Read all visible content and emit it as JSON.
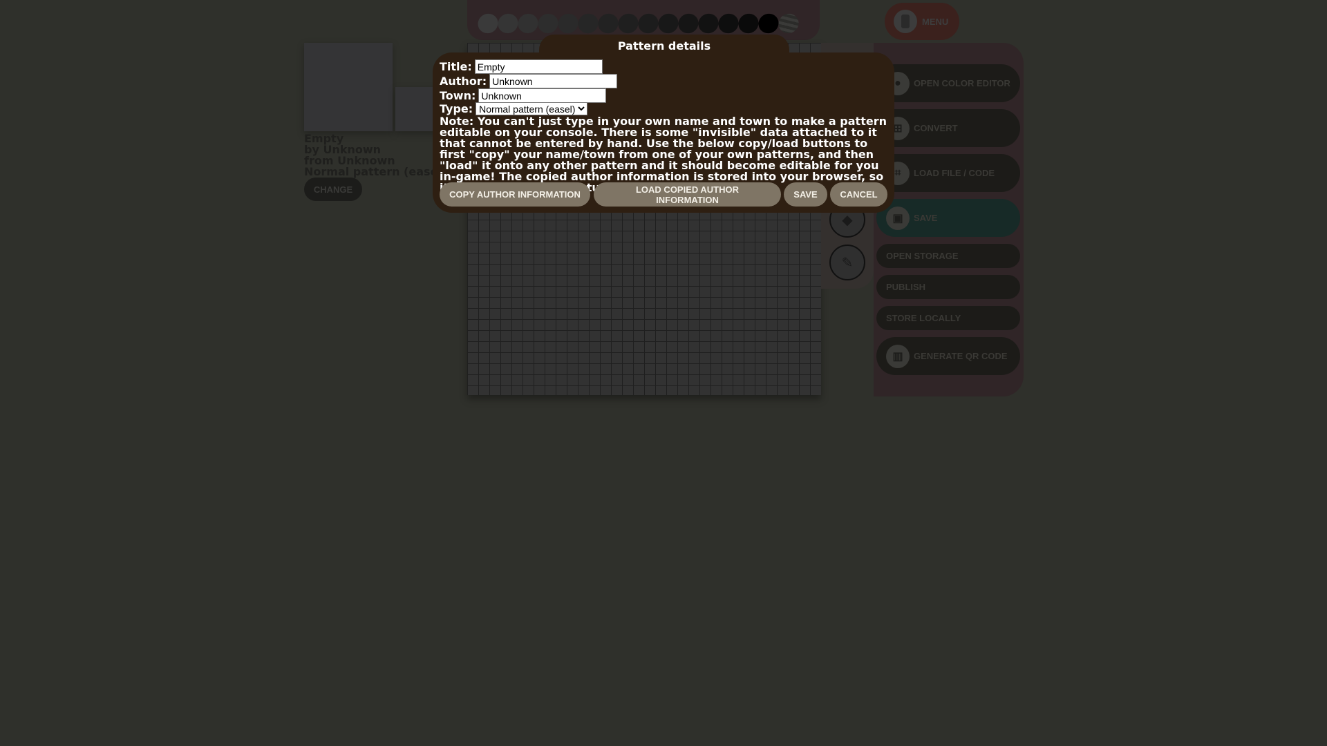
{
  "preview": {
    "title": "Empty",
    "author_line": "by Unknown",
    "town_line": "from Unknown",
    "type_line": "Normal pattern (easel)",
    "change_label": "CHANGE"
  },
  "palette": {
    "swatches": [
      "#3a3a3a",
      "#353535",
      "#313131",
      "#2d2d2d",
      "#2a2a2a",
      "#262626",
      "#222222",
      "#1f1f1f",
      "#1c1c1c",
      "#181818",
      "#151515",
      "#121212",
      "#0e0e0e",
      "#0a0a0a",
      "#000000"
    ],
    "clear_icon": "transparent-swatch-icon"
  },
  "tools": [
    {
      "name": "paint-bucket-icon",
      "glyph": "◆"
    },
    {
      "name": "eyedropper-icon",
      "glyph": "✎"
    }
  ],
  "menu": {
    "label": "MENU",
    "icon": "phone-icon"
  },
  "actions": [
    {
      "label": "OPEN COLOR EDITOR",
      "icon": "palette-icon",
      "glyph": "🎨",
      "size": "big"
    },
    {
      "label": "CONVERT",
      "icon": "image-convert-icon",
      "glyph": "⊞",
      "size": "big"
    },
    {
      "label": "LOAD FILE / CODE",
      "icon": "scan-icon",
      "glyph": "⌗",
      "size": "big"
    },
    {
      "label": "SAVE",
      "icon": "floppy-icon",
      "glyph": "▣",
      "size": "big"
    },
    {
      "label": "OPEN STORAGE",
      "size": "small"
    },
    {
      "label": "PUBLISH",
      "size": "small"
    },
    {
      "label": "STORE LOCALLY",
      "size": "small"
    },
    {
      "label": "GENERATE QR CODE",
      "icon": "qr-scan-icon",
      "glyph": "▥",
      "size": "big"
    }
  ],
  "modal": {
    "title": "Pattern details",
    "title_label": "Title:",
    "title_value": "Empty",
    "author_label": "Author:",
    "author_value": "Unknown",
    "town_label": "Town:",
    "town_value": "Unknown",
    "type_label": "Type:",
    "type_value": "Normal pattern (easel)",
    "note": "Note: You can't just type in your own name and town to make a pattern editable on your console. There is some \"invisible\" data attached to it that cannot be entered by hand. Use the below copy/load buttons to first \"copy\" your name/town from one of your own patterns, and then \"load\" it onto any other pattern and it should become editable for you in-game! The copied author information is stored into your browser, so it'll be there for your future visits as well.",
    "buttons": {
      "copy": "COPY AUTHOR INFORMATION",
      "load": "LOAD COPIED AUTHOR INFORMATION",
      "save": "SAVE",
      "cancel": "CANCEL"
    }
  }
}
